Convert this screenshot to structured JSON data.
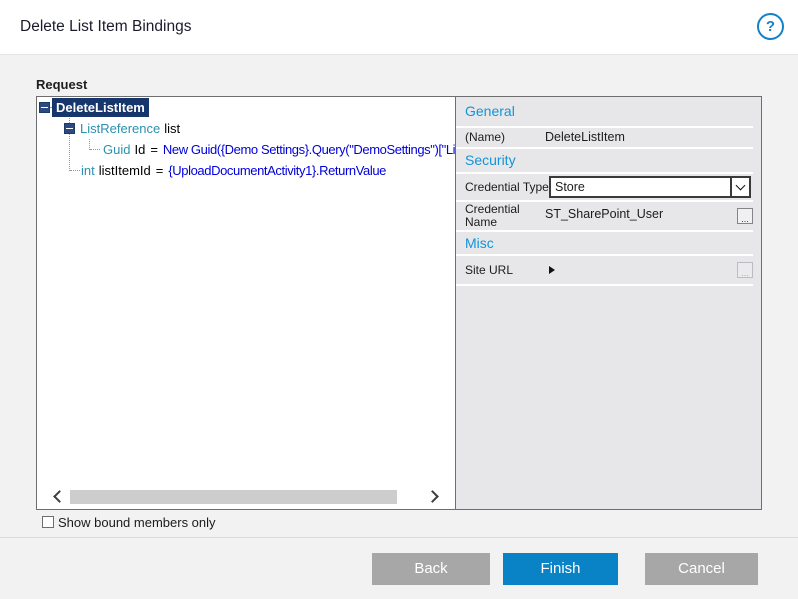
{
  "dialog": {
    "title": "Delete List Item Bindings",
    "help_icon": "?"
  },
  "request": {
    "label": "Request",
    "tree": {
      "root": {
        "name": "DeleteListItem"
      },
      "nodes": [
        {
          "type": "ListReference",
          "name": "list"
        },
        {
          "type": "Guid",
          "name": "Id",
          "eq": "=",
          "value": "New Guid({Demo Settings}.Query(\"DemoSettings\")[\"ListGuid\"])"
        },
        {
          "type": "int",
          "name": "listItemId",
          "eq": "=",
          "value": "{UploadDocumentActivity1}.ReturnValue"
        }
      ]
    }
  },
  "properties": {
    "sections": {
      "general": "General",
      "security": "Security",
      "misc": "Misc"
    },
    "name": {
      "label": "(Name)",
      "value": "DeleteListItem"
    },
    "credential_type": {
      "label": "Credential Type",
      "value": "Store"
    },
    "credential_name": {
      "label": "Credential Name",
      "value": "ST_SharePoint_User",
      "browse": "..."
    },
    "site_url": {
      "label": "Site URL",
      "browse": "..."
    }
  },
  "footer": {
    "show_bound_label": "Show bound members only",
    "back": "Back",
    "finish": "Finish",
    "cancel": "Cancel"
  },
  "colors": {
    "accent_blue": "#0a82c6",
    "section_blue": "#0f9bd9",
    "selection_navy": "#17366b",
    "type_teal": "#2b91af",
    "expression_blue": "#0000dd"
  }
}
